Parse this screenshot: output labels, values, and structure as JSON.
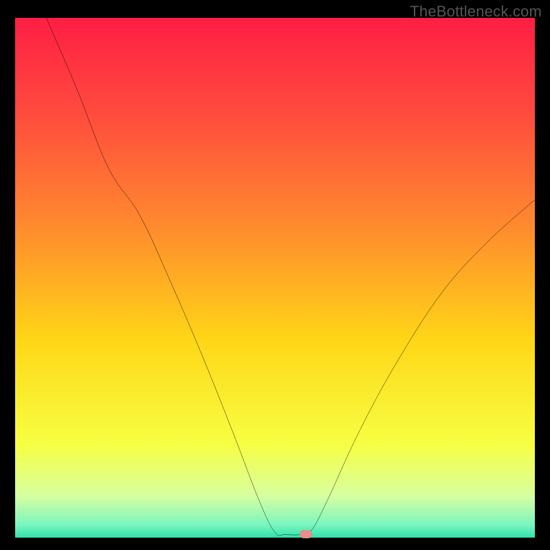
{
  "watermark": "TheBottleneck.com",
  "chart_data": {
    "type": "line",
    "title": "",
    "xlabel": "",
    "ylabel": "",
    "x_range": [
      0,
      100
    ],
    "y_range": [
      0,
      100
    ],
    "background_gradient_stops": [
      {
        "offset": 0.0,
        "color": "#ff1e44"
      },
      {
        "offset": 0.18,
        "color": "#ff4a3e"
      },
      {
        "offset": 0.4,
        "color": "#ff8a2e"
      },
      {
        "offset": 0.62,
        "color": "#ffd617"
      },
      {
        "offset": 0.82,
        "color": "#f7ff43"
      },
      {
        "offset": 0.92,
        "color": "#d7ffa0"
      },
      {
        "offset": 0.975,
        "color": "#7cf5c0"
      },
      {
        "offset": 1.0,
        "color": "#2fe3aa"
      }
    ],
    "series": [
      {
        "name": "bottleneck-curve",
        "stroke": "#000000",
        "points": [
          {
            "x": 6,
            "y": 100
          },
          {
            "x": 12,
            "y": 86
          },
          {
            "x": 18,
            "y": 71
          },
          {
            "x": 24,
            "y": 62
          },
          {
            "x": 30,
            "y": 49
          },
          {
            "x": 36,
            "y": 35
          },
          {
            "x": 42,
            "y": 20
          },
          {
            "x": 47,
            "y": 7
          },
          {
            "x": 50,
            "y": 1.0
          },
          {
            "x": 52,
            "y": 0.6
          },
          {
            "x": 55,
            "y": 0.6
          },
          {
            "x": 57,
            "y": 1.4
          },
          {
            "x": 60,
            "y": 7
          },
          {
            "x": 66,
            "y": 20
          },
          {
            "x": 73,
            "y": 33
          },
          {
            "x": 82,
            "y": 47
          },
          {
            "x": 91,
            "y": 57
          },
          {
            "x": 100,
            "y": 65
          }
        ]
      }
    ],
    "marker": {
      "x": 56,
      "y": 0.6,
      "color": "#e98f8a"
    }
  }
}
